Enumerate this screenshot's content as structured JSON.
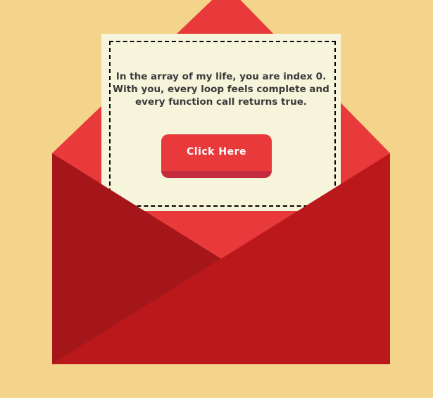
{
  "colors": {
    "background": "#f4d48a",
    "flap_red": "#e8393b",
    "pocket_left": "#a4161a",
    "pocket_right": "#ba181b",
    "letter_paper": "#f6f5dc",
    "button_face": "#e8393b",
    "button_shadow": "#c42b3c",
    "text_dark": "#3a3a3a"
  },
  "letter": {
    "message": "In the array of my life, you are index 0. With you, every loop feels complete and every function call returns true."
  },
  "button": {
    "label": "Click Here"
  },
  "icons": {
    "envelope": "open-envelope-icon"
  }
}
